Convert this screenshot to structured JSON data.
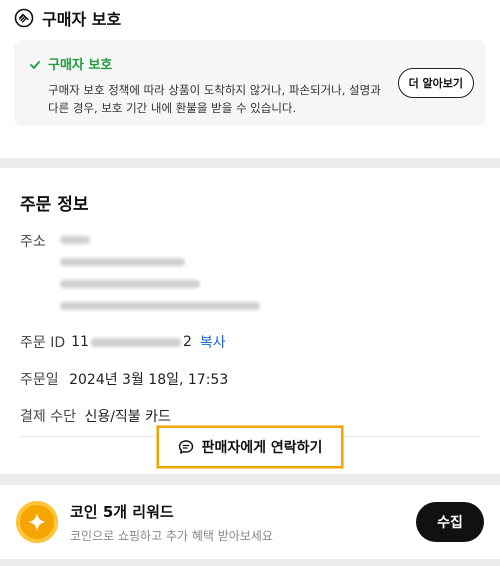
{
  "protection": {
    "header_title": "구매자 보호",
    "box_title": "구매자 보호",
    "description": "구매자 보호 정책에 따라 상품이 도착하지 않거나, 파손되거나, 설명과 다른 경우, 보호 기간 내에 환불을 받을 수 있습니다.",
    "learn_more_label": "더 알아보기"
  },
  "order_info": {
    "title": "주문 정보",
    "address_label": "주소",
    "order_id_label": "주문 ID",
    "order_id_prefix": "11",
    "order_id_suffix": "2",
    "copy_label": "복사",
    "order_date_label": "주문일",
    "order_date_value": "2024년 3월 18일, 17:53",
    "payment_label": "결제 수단",
    "payment_value": "신용/직불 카드",
    "contact_seller_label": "판매자에게 연락하기"
  },
  "reward": {
    "title": "코인 5개 리워드",
    "subtitle": "코인으로 쇼핑하고 추가 혜택 받아보세요",
    "collect_label": "수집"
  },
  "colors": {
    "accent_green": "#1f9d3a",
    "link_blue": "#1766d6",
    "highlight_orange": "#f1a400",
    "coin_orange": "#f5a500"
  },
  "icons": {
    "protection": "hand-shield-icon",
    "check": "check-icon",
    "chat": "chat-bubble-icon",
    "coin": "coin-sparkle-icon"
  }
}
